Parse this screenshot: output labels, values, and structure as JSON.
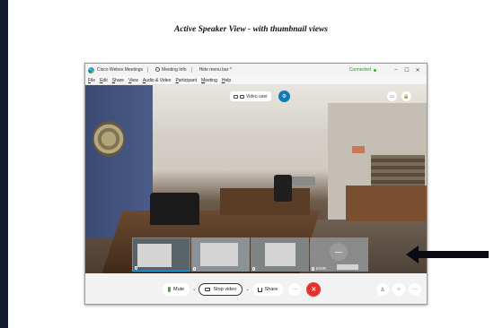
{
  "caption": "Active Speaker View - with thumbnail views",
  "titlebar": {
    "app": "Cisco Webex Meetings",
    "meeting_info": "Meeting Info",
    "hide_menu": "Hide menu bar ^",
    "status": "Connected",
    "minimize": "–",
    "maximize": "☐",
    "close": "✕"
  },
  "menu": [
    "File",
    "Edit",
    "Share",
    "View",
    "Audio & Video",
    "Participant",
    "Meeting",
    "Help"
  ],
  "video_header": {
    "view_label": "Video user"
  },
  "thumbnails": [
    {
      "label": "",
      "active": true
    },
    {
      "label": "",
      "active": false
    },
    {
      "label": "",
      "active": false
    },
    {
      "label": "EOIR",
      "active": false
    }
  ],
  "controls": {
    "mute": "Mute",
    "stop_video": "Stop video",
    "share": "Share",
    "more": "···",
    "end": "✕"
  },
  "colors": {
    "accent_blue": "#117ab8",
    "active_border": "#27a0e6",
    "end_red": "#e5322c",
    "connected_green": "#3caf3c"
  }
}
